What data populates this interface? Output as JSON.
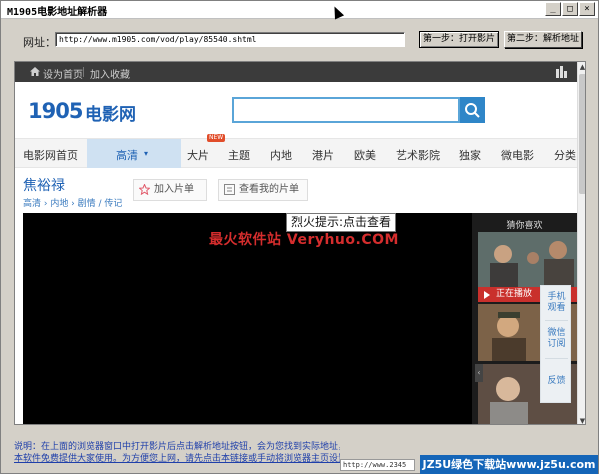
{
  "window": {
    "title": "M1905电影地址解析器",
    "controls": [
      "0",
      "1",
      "r"
    ]
  },
  "urlbar": {
    "label": "网址：",
    "url_value": "http://www.m1905.com/vod/play/85540.shtml",
    "step1_button": "第一步：打开影片",
    "step2_button": "第二步：解析地址"
  },
  "site": {
    "topnav": {
      "set_home": "设为首页",
      "bookmark": "加入收藏"
    },
    "logo_mark": "1905",
    "logo_text": "电影网",
    "search_placeholder": "",
    "nav": {
      "home": "电影网首页",
      "active": "高清",
      "active_caret": "▾",
      "items": [
        "大片",
        "主题",
        "内地",
        "港片",
        "欧美",
        "艺术影院",
        "独家",
        "微电影",
        "分类"
      ],
      "badge": "NEW"
    },
    "film_title": "焦裕禄",
    "breadcrumb": "高清 › 内地 › 剧情 / 传记",
    "add_to_list": "加入片单",
    "view_my_list": "查看我的片单",
    "watermark": "最火软件站 Veryhuo.COM",
    "tooltip": "烈火提示:点击查看",
    "sidepanel": {
      "header": "猜你喜欢",
      "now_playing": "正在播放",
      "float_items": [
        "手机\n观看",
        "微信\n订阅",
        "反馈"
      ]
    }
  },
  "footer": {
    "note_line1": "说明：在上面的浏览器窗口中打开影片后点击解析地址按钮，会为您找到实际地址，其",
    "note_line2": "本软件免费提供大家使用。为方便您上网，请先点击本链接或手动将浏览器主页设置为",
    "status_url": "http://www.2345",
    "site_badge": "JZ5U绿色下载站www.jz5u.com"
  }
}
